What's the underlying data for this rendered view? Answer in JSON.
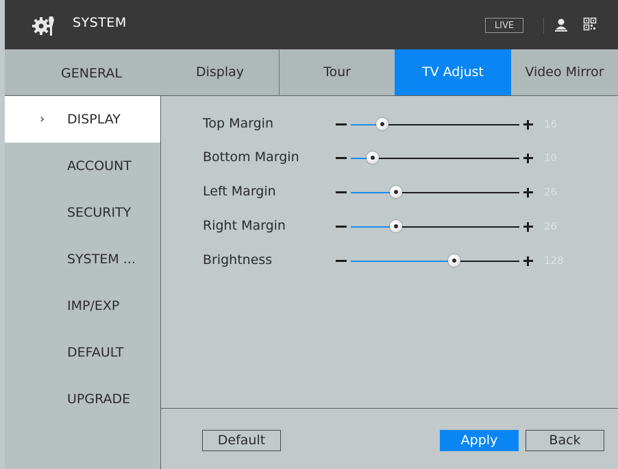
{
  "header": {
    "title": "SYSTEM",
    "live_label": "LIVE",
    "icons": [
      "gear-icon",
      "user-icon",
      "qr-code-icon"
    ]
  },
  "tabs": {
    "section_label": "GENERAL",
    "items": [
      {
        "label": "Display"
      },
      {
        "label": "Tour"
      },
      {
        "label": "TV Adjust",
        "active": true
      },
      {
        "label": "Video Mirror"
      }
    ]
  },
  "sidebar": {
    "items": [
      {
        "label": "DISPLAY",
        "active": true
      },
      {
        "label": "ACCOUNT"
      },
      {
        "label": "SECURITY"
      },
      {
        "label": "SYSTEM ..."
      },
      {
        "label": "IMP/EXP"
      },
      {
        "label": "DEFAULT"
      },
      {
        "label": "UPGRADE"
      }
    ]
  },
  "settings": {
    "rows": [
      {
        "label": "Top Margin",
        "value": "16"
      },
      {
        "label": "Bottom Margin",
        "value": "10"
      },
      {
        "label": "Left Margin",
        "value": "26"
      },
      {
        "label": "Right Margin",
        "value": "26"
      },
      {
        "label": "Brightness",
        "value": "128"
      }
    ]
  },
  "buttons": {
    "default_label": "Default",
    "apply_label": "Apply",
    "back_label": "Back"
  },
  "colors": {
    "accent": "#0a86f4",
    "header_bg": "#383838",
    "panel_bg": "#c1c9ca"
  }
}
